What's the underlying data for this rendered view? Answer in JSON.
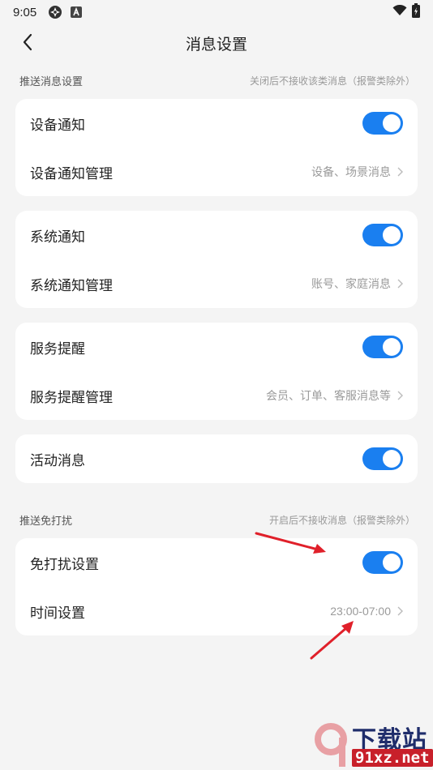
{
  "status_bar": {
    "time": "9:05",
    "icons": [
      "app-notification-icon",
      "a-badge-icon",
      "wifi-icon",
      "battery-icon"
    ]
  },
  "header": {
    "title": "消息设置",
    "back_icon": "chevron-left-icon"
  },
  "push_section": {
    "title": "推送消息设置",
    "note": "关闭后不接收该类消息（报警类除外）"
  },
  "cards": [
    {
      "toggle_label": "设备通知",
      "toggle_on": true,
      "manage_label": "设备通知管理",
      "manage_value": "设备、场景消息"
    },
    {
      "toggle_label": "系统通知",
      "toggle_on": true,
      "manage_label": "系统通知管理",
      "manage_value": "账号、家庭消息"
    },
    {
      "toggle_label": "服务提醒",
      "toggle_on": true,
      "manage_label": "服务提醒管理",
      "manage_value": "会员、订单、客服消息等"
    },
    {
      "toggle_label": "活动消息",
      "toggle_on": true
    }
  ],
  "dnd_section": {
    "title": "推送免打扰",
    "note": "开启后不接收消息（报警类除外）",
    "toggle_label": "免打扰设置",
    "toggle_on": true,
    "time_label": "时间设置",
    "time_value": "23:00-07:00"
  },
  "watermark": {
    "logo_text": "下载站",
    "url_text": "91xz.net"
  },
  "colors": {
    "toggle_on": "#1a7ff0",
    "annotation_arrow": "#e0202a",
    "background": "#f4f4f4"
  }
}
